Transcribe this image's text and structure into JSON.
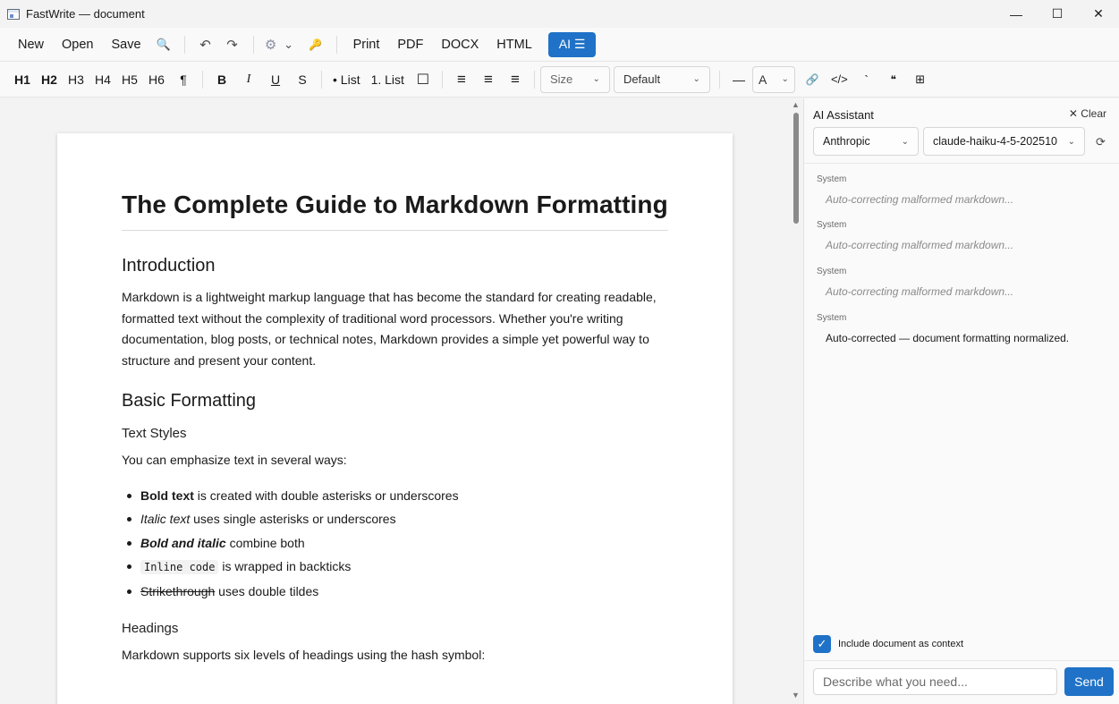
{
  "window": {
    "title": "FastWrite — document",
    "minimize": "—",
    "maximize": "☐",
    "close": "✕"
  },
  "menubar": {
    "new": "New",
    "open": "Open",
    "save": "Save",
    "search_icon": "🔍",
    "undo_icon": "↶",
    "redo_icon": "↷",
    "settings_icon": "⚙",
    "settings_chevron": "⌄",
    "key_icon": "🔑",
    "print": "Print",
    "pdf": "PDF",
    "docx": "DOCX",
    "html": "HTML",
    "ai": "AI ☰"
  },
  "format": {
    "h1": "H1",
    "h2": "H2",
    "h3": "H3",
    "h4": "H4",
    "h5": "H5",
    "h6": "H6",
    "paragraph": "¶",
    "bold": "B",
    "italic": "I",
    "underline": "U",
    "strike": "S",
    "bullet_list": "• List",
    "numbered_list": "1. List",
    "checkbox": "☐",
    "align_left": "≡",
    "align_center": "≡",
    "align_right": "≡",
    "size": "Size",
    "font": "Default",
    "hr": "—",
    "color": "A",
    "link": "🔗",
    "code_block": "</>",
    "inline_code": "`",
    "quote": "❝",
    "table": "⊞",
    "chevron": "⌄"
  },
  "document": {
    "title": "The Complete Guide to Markdown Formatting",
    "intro_heading": "Introduction",
    "intro_text": "Markdown is a lightweight markup language that has become the standard for creating readable, formatted text without the complexity of traditional word processors. Whether you're writing documentation, blog posts, or technical notes, Markdown provides a simple yet powerful way to structure and present your content.",
    "basic_heading": "Basic Formatting",
    "text_styles_heading": "Text Styles",
    "text_styles_intro": "You can emphasize text in several ways:",
    "list": {
      "bold_term": "Bold text",
      "bold_desc": " is created with double asterisks or underscores",
      "italic_term": "Italic text",
      "italic_desc": " uses single asterisks or underscores",
      "bolditalic_term": "Bold and italic",
      "bolditalic_desc": " combine both",
      "code_term": "Inline code",
      "code_desc": " is wrapped in backticks",
      "strike_term": "Strikethrough",
      "strike_desc": " uses double tildes"
    },
    "headings_heading": "Headings",
    "headings_text": "Markdown supports six levels of headings using the hash symbol:"
  },
  "ai_panel": {
    "title": "AI Assistant",
    "clear": "✕ Clear",
    "provider": "Anthropic",
    "model": "claude-haiku-4-5-202510",
    "refresh_icon": "⟳",
    "messages": [
      {
        "role": "System",
        "text": "Auto-correcting malformed markdown..."
      },
      {
        "role": "System",
        "text": "Auto-correcting malformed markdown..."
      },
      {
        "role": "System",
        "text": "Auto-correcting malformed markdown..."
      },
      {
        "role": "System",
        "text": "Auto-corrected — document formatting normalized."
      }
    ],
    "include_context_label": "Include document as context",
    "checkbox_mark": "✓",
    "input_placeholder": "Describe what you need...",
    "send": "Send"
  },
  "colors": {
    "accent": "#1f72c7",
    "background": "#f3f3f3"
  }
}
